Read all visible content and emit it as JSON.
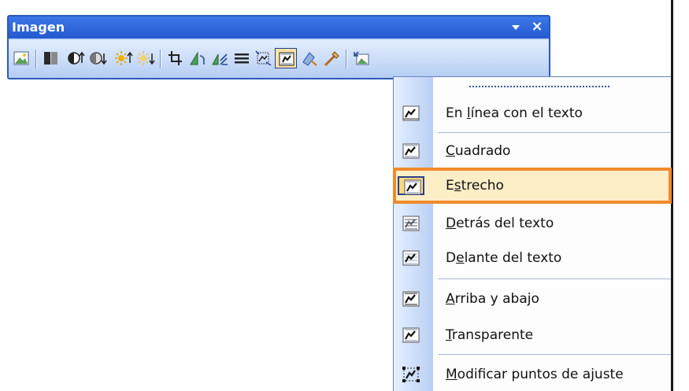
{
  "toolbar": {
    "title": "Imagen",
    "dropdown_icon": "triangle-down-icon",
    "close_glyph": "×",
    "buttons": [
      {
        "name": "insert-picture-icon"
      },
      {
        "name": "color-icon"
      },
      {
        "name": "more-contrast-icon"
      },
      {
        "name": "less-contrast-icon"
      },
      {
        "name": "more-brightness-icon"
      },
      {
        "name": "less-brightness-icon"
      },
      {
        "name": "crop-icon"
      },
      {
        "name": "rotate-left-icon"
      },
      {
        "name": "compress-pictures-icon"
      },
      {
        "name": "line-style-icon"
      },
      {
        "name": "text-wrapping-icon",
        "active": true
      },
      {
        "name": "format-picture-icon"
      },
      {
        "name": "set-transparent-color-icon"
      },
      {
        "name": "reset-picture-icon"
      }
    ]
  },
  "menu": {
    "items": [
      {
        "pre": "En ",
        "u": "l",
        "post": "ínea con el texto",
        "icon": "wrap-inline-icon"
      },
      {
        "pre": "",
        "u": "C",
        "post": "uadrado",
        "icon": "wrap-square-icon"
      },
      {
        "pre": "E",
        "u": "s",
        "post": "trecho",
        "icon": "wrap-tight-icon",
        "highlighted": true
      },
      {
        "pre": "",
        "u": "D",
        "post": "etrás del texto",
        "icon": "wrap-behind-text-icon"
      },
      {
        "pre": "D",
        "u": "e",
        "post": "lante del texto",
        "icon": "wrap-in-front-icon"
      },
      {
        "pre": "",
        "u": "A",
        "post": "rriba y abajo",
        "icon": "wrap-top-bottom-icon"
      },
      {
        "pre": "",
        "u": "T",
        "post": "ransparente",
        "icon": "wrap-through-icon"
      },
      {
        "pre": "",
        "u": "M",
        "post": "odificar puntos de ajuste",
        "icon": "edit-wrap-points-icon"
      }
    ]
  },
  "colors": {
    "titlebar": "#2c5ad0",
    "highlight_outline": "#f08a2c",
    "highlight_fill": "#fdeec7"
  }
}
